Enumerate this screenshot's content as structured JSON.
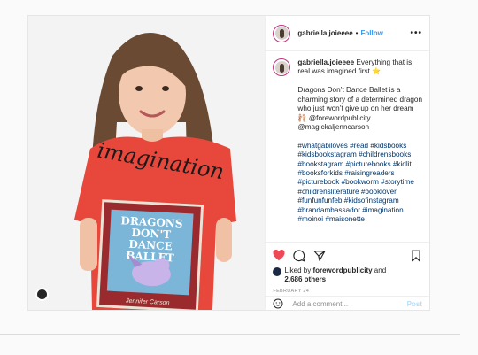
{
  "post": {
    "username": "gabriella.joieeee",
    "separator": "•",
    "follow_label": "Follow",
    "more_label": "•••",
    "caption_intro": "Everything that is real was imagined first ⭐",
    "caption_para": "Dragons Don’t Dance Ballet is a charming story of a determined dragon who just won’t give up on her dream 🩰 @forewordpublicity @magickaljenncarson",
    "hashtags": "#whatgabiloves #read #kidsbooks #kidsbookstagram #childrensbooks #bookstagram #picturebooks #kidlit #booksforkids #raisingreaders #picturebook #bookworm #storytime #childrensliterature #booklover #funfunfunfeb #kidsofinstagram #brandambassador #imagination #moinoi #maisonette",
    "liked_by_prefix": "Liked by",
    "liked_by_user": "forewordpublicity",
    "liked_by_and": "and",
    "likes_count": "2,686 others",
    "date": "FEBRUARY 24",
    "comment_placeholder": "Add a comment...",
    "post_label": "Post",
    "shirt_text": "imagination",
    "book_title": "DRAGONS DON'T DANCE BALLET",
    "book_author": "Jennifer Carson"
  },
  "colors": {
    "accent_blue": "#3897f0",
    "like_red": "#ed4956",
    "shirt_red": "#e8473c"
  },
  "icons": [
    "heart-icon",
    "comment-icon",
    "share-icon",
    "bookmark-icon",
    "smiley-icon",
    "more-icon"
  ]
}
